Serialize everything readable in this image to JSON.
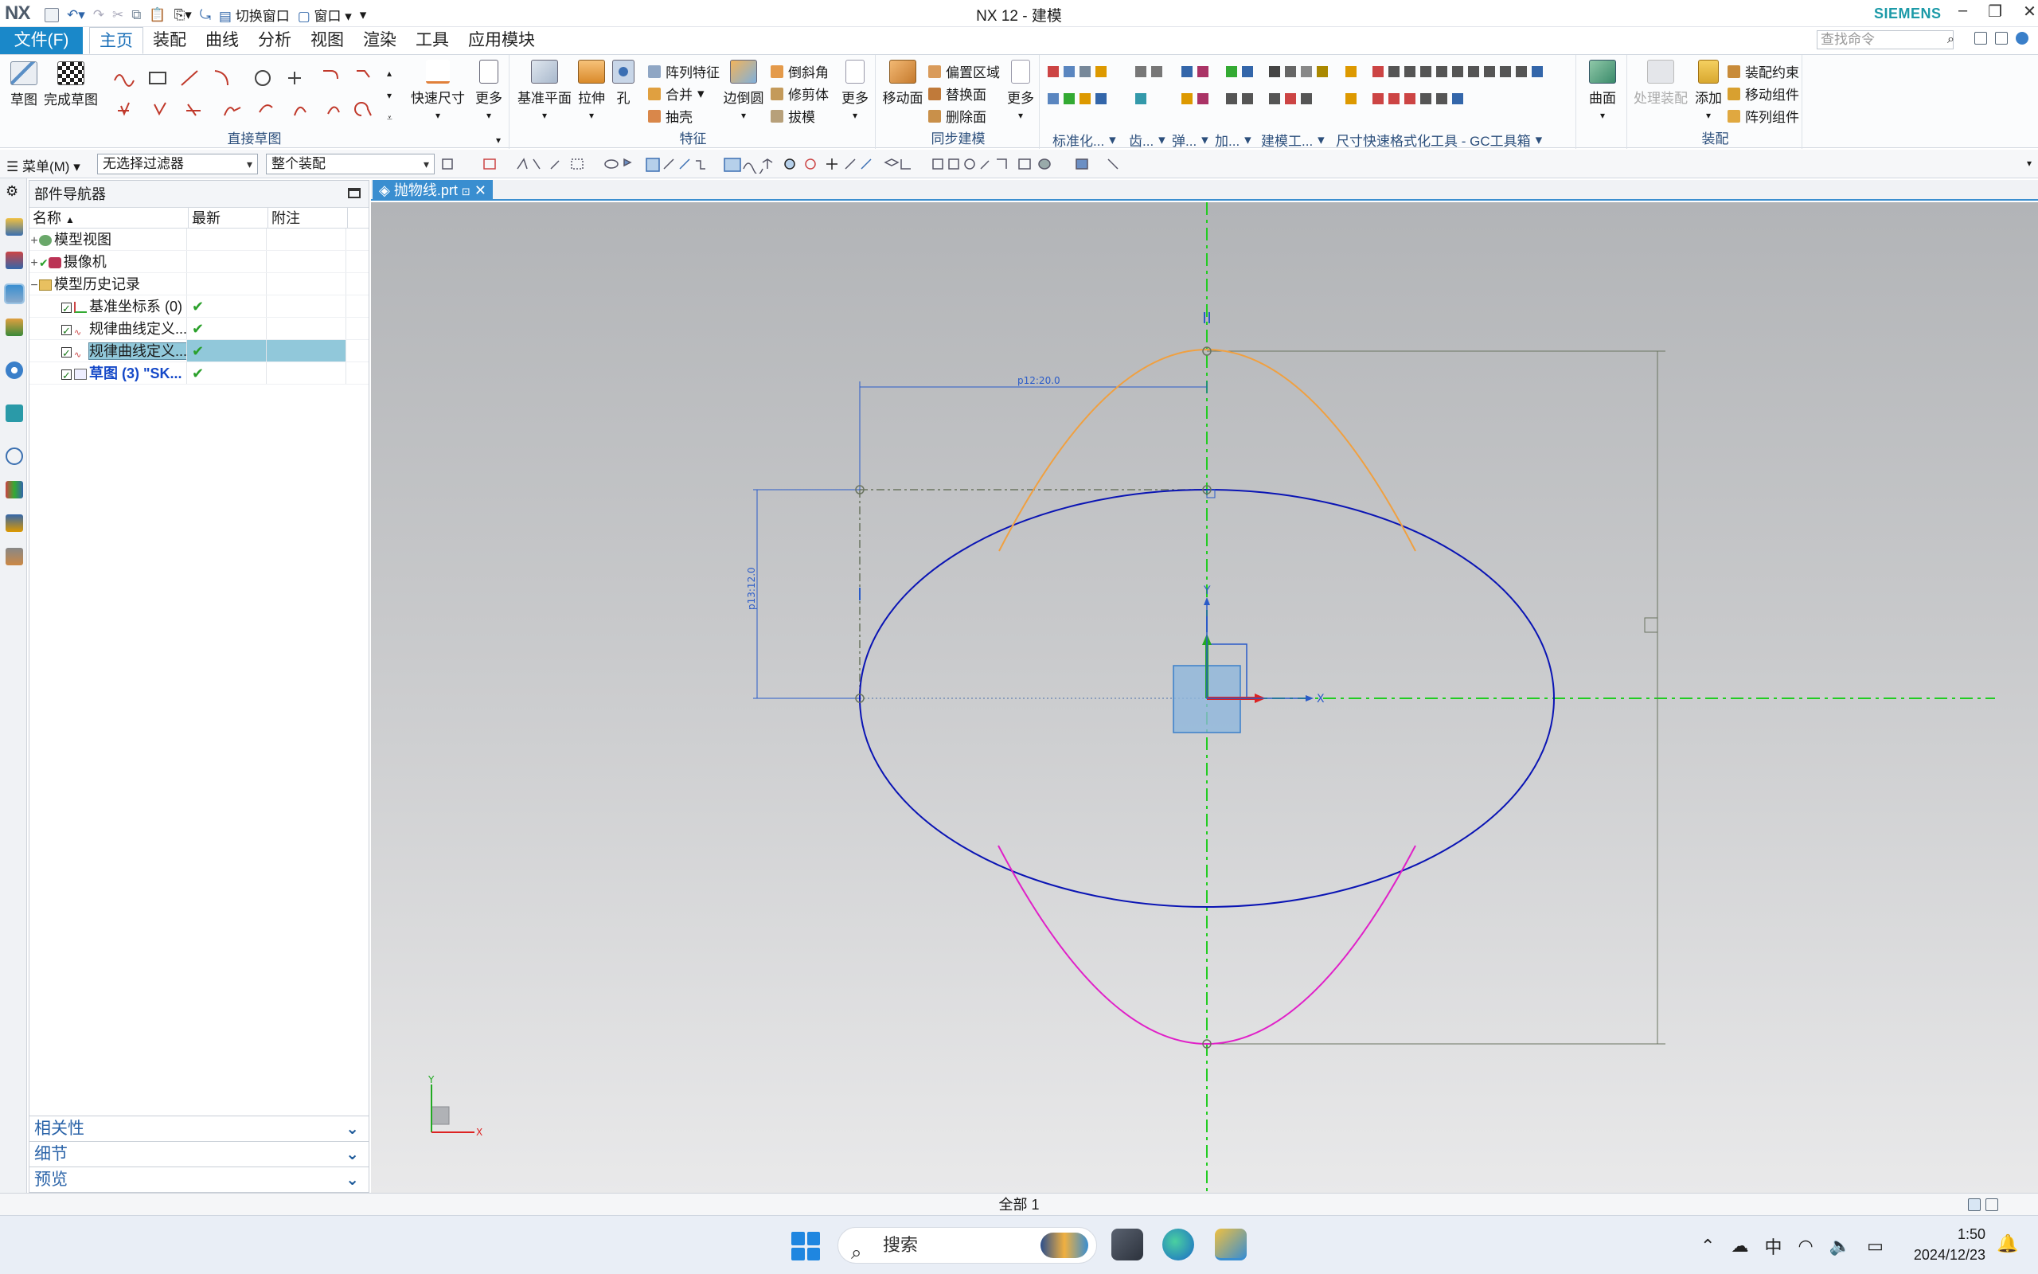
{
  "titlebar": {
    "logo": "NX",
    "switch_window": "切换窗口",
    "window_menu": "窗口",
    "title": "NX 12 - 建模",
    "brand": "SIEMENS"
  },
  "menu": {
    "file": "文件(F)",
    "tabs": [
      "主页",
      "装配",
      "曲线",
      "分析",
      "视图",
      "渲染",
      "工具",
      "应用模块"
    ],
    "search_placeholder": "查找命令"
  },
  "ribbon": {
    "sketch": "草图",
    "finish_sketch": "完成草图",
    "quick_dim": "快速尺寸",
    "more1": "更多",
    "direct_sketch": "直接草图",
    "datum_plane": "基准平面",
    "extrude": "拉伸",
    "hole": "孔",
    "pattern_feature": "阵列特征",
    "unite": "合并",
    "shell": "抽壳",
    "edge_blend": "边倒圆",
    "chamfer": "倒斜角",
    "trim_body": "修剪体",
    "draft": "拔模",
    "more2": "更多",
    "feature": "特征",
    "move_face": "移动面",
    "offset_region": "偏置区域",
    "replace_face": "替换面",
    "delete_face": "删除面",
    "more3": "更多",
    "sync_modeling": "同步建模",
    "std": "标准化...",
    "gear": "齿...",
    "spring": "弹...",
    "add": "加...",
    "modeling_tools": "建模工...",
    "gc_toolbox": "尺寸快速格式化工具 - GC工具箱",
    "surface": "曲面",
    "process_assembly": "处理装配",
    "add_component": "添加",
    "assy_constraint": "装配约束",
    "move_component": "移动组件",
    "pattern_component": "阵列组件",
    "assembly": "装配"
  },
  "toolbar2": {
    "menu": "菜单(M)",
    "filter": "无选择过滤器",
    "scope": "整个装配"
  },
  "navigator": {
    "title": "部件导航器",
    "columns": [
      "名称",
      "最新",
      "附注"
    ],
    "rows": [
      {
        "label": "模型视图",
        "expander": "+",
        "check": false,
        "latest": ""
      },
      {
        "label": "摄像机",
        "expander": "+",
        "check": false,
        "latest": ""
      },
      {
        "label": "模型历史记录",
        "expander": "−",
        "check": false,
        "latest": ""
      },
      {
        "label": "基准坐标系 (0)",
        "expander": "",
        "check": true,
        "latest": "✔"
      },
      {
        "label": "规律曲线定义...",
        "expander": "",
        "check": true,
        "latest": "✔"
      },
      {
        "label": "规律曲线定义...",
        "expander": "",
        "check": true,
        "latest": "✔"
      },
      {
        "label": "草图 (3) \"SK...",
        "expander": "",
        "check": true,
        "latest": "✔"
      }
    ],
    "panels": [
      "相关性",
      "细节",
      "预览"
    ]
  },
  "document": {
    "tab": "抛物线.prt"
  },
  "sketch": {
    "dim_horizontal": "p12:20.0",
    "dim_vertical": "p13:12.0",
    "axis_x": "X",
    "axis_y": "Y",
    "ellipse_color": "#0a14b4",
    "upper_parabola_color": "#f0a040",
    "lower_parabola_color": "#e020c8",
    "axis_color": "#22cc22"
  },
  "status": {
    "text": "全部 1"
  },
  "taskbar": {
    "search": "搜索",
    "ime": "中",
    "time": "1:50",
    "date": "2024/12/23"
  }
}
